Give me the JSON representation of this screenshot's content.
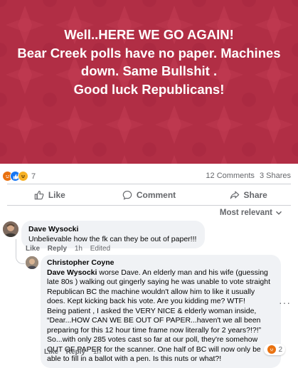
{
  "post": {
    "lines": [
      "Well..HERE WE GO AGAIN!",
      "Bear Creek polls have no paper. Machines",
      "down. Same Bullshit .",
      "Good luck Republicans!"
    ],
    "background_color": "#b12e45"
  },
  "stats": {
    "reaction_count": "7",
    "reaction_icons": [
      "angry-icon",
      "like-icon",
      "haha-icon"
    ],
    "comments": "12 Comments",
    "shares": "3 Shares"
  },
  "actions": {
    "like": "Like",
    "comment": "Comment",
    "share": "Share"
  },
  "sort_label": "Most relevant",
  "comments": [
    {
      "author": "Dave Wysocki",
      "text": "Unbelievable how the fk can they be out of paper!!!",
      "like": "Like",
      "reply": "Reply",
      "time": "1h",
      "edited": "Edited"
    }
  ],
  "reply": {
    "author": "Christopher Coyne",
    "mention": "Dave Wysocki",
    "text_after_mention": " worse Dave. An elderly man and his wife (guessing late 80s ) walking out gingerly saying he was unable to vote straight Republican BC the machine wouldn't allow him to like it usually does. Kept kicking back his vote. Are you kidding me? WTF!\nBeing patient , I asked the VERY NICE & elderly woman inside, “Dear...HOW CAN WE BE OUT OF PAPER...haven't we all been preparing for this 12 hour time frame now literally for 2 years?!?!” So...with only 285 votes cast so far at our poll, they're somehow OUT OF PAPER for the scanner. One half of BC will now only be able to fill in a ballot with a pen. Is this nuts or what?!",
    "like": "Like",
    "reply": "Reply",
    "time": "1h",
    "reaction_count": "2",
    "reaction_icon": "angry-icon"
  }
}
